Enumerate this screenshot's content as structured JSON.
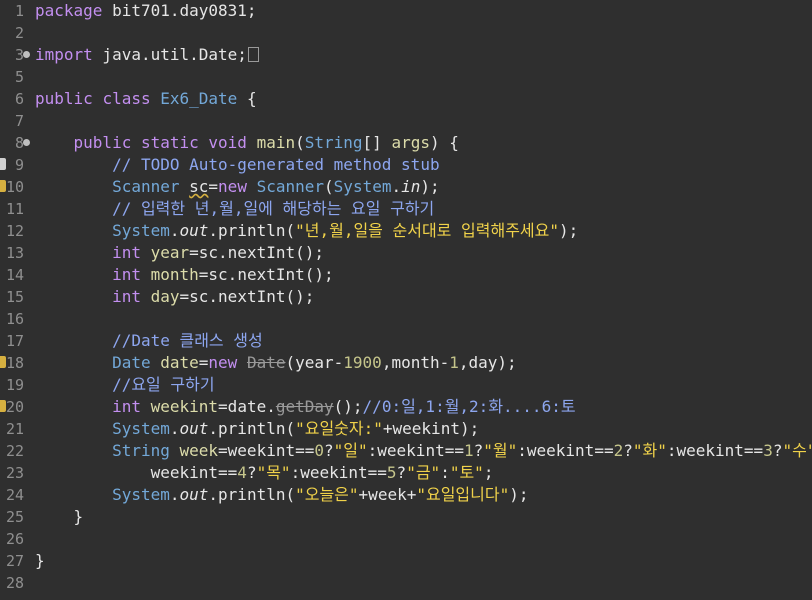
{
  "editor": {
    "lines": [
      {
        "n": "1",
        "t": [
          {
            "c": "kw",
            "v": "package"
          },
          {
            "c": "",
            "v": " bit701.day0831;"
          }
        ]
      },
      {
        "n": "2",
        "t": []
      },
      {
        "n": "3",
        "marker": true,
        "t": [
          {
            "c": "kw",
            "v": "import"
          },
          {
            "c": "",
            "v": " java.util.Date;"
          },
          {
            "c": "box",
            "v": ""
          }
        ]
      },
      {
        "n": "5",
        "t": []
      },
      {
        "n": "6",
        "t": [
          {
            "c": "kw",
            "v": "public"
          },
          {
            "c": "",
            "v": " "
          },
          {
            "c": "kw",
            "v": "class"
          },
          {
            "c": "",
            "v": " "
          },
          {
            "c": "ty",
            "v": "Ex6_Date"
          },
          {
            "c": "",
            "v": " {"
          }
        ]
      },
      {
        "n": "7",
        "t": []
      },
      {
        "n": "8",
        "marker": true,
        "t": [
          {
            "c": "",
            "v": "    "
          },
          {
            "c": "kw",
            "v": "public"
          },
          {
            "c": "",
            "v": " "
          },
          {
            "c": "kw",
            "v": "static"
          },
          {
            "c": "",
            "v": " "
          },
          {
            "c": "kw",
            "v": "void"
          },
          {
            "c": "",
            "v": " "
          },
          {
            "c": "fld",
            "v": "main"
          },
          {
            "c": "",
            "v": "("
          },
          {
            "c": "ty",
            "v": "String"
          },
          {
            "c": "",
            "v": "[] "
          },
          {
            "c": "fld",
            "v": "args"
          },
          {
            "c": "",
            "v": ") {"
          }
        ]
      },
      {
        "n": "9",
        "ann": "note",
        "t": [
          {
            "c": "",
            "v": "        "
          },
          {
            "c": "cm",
            "v": "// TODO Auto-generated method stub"
          }
        ]
      },
      {
        "n": "10",
        "ann": "warn",
        "t": [
          {
            "c": "",
            "v": "        "
          },
          {
            "c": "ty",
            "v": "Scanner"
          },
          {
            "c": "",
            "v": " "
          },
          {
            "c": "warnu",
            "v": "sc"
          },
          {
            "c": "",
            "v": "="
          },
          {
            "c": "kw",
            "v": "new"
          },
          {
            "c": "",
            "v": " "
          },
          {
            "c": "ty",
            "v": "Scanner"
          },
          {
            "c": "",
            "v": "("
          },
          {
            "c": "ty",
            "v": "System"
          },
          {
            "c": "",
            "v": "."
          },
          {
            "c": "ital",
            "v": "in"
          },
          {
            "c": "",
            "v": ");"
          }
        ]
      },
      {
        "n": "11",
        "t": [
          {
            "c": "",
            "v": "        "
          },
          {
            "c": "cm",
            "v": "// 입력한 년,월,일에 해당하는 요일 구하기"
          }
        ]
      },
      {
        "n": "12",
        "t": [
          {
            "c": "",
            "v": "        "
          },
          {
            "c": "ty",
            "v": "System"
          },
          {
            "c": "",
            "v": "."
          },
          {
            "c": "ital",
            "v": "out"
          },
          {
            "c": "",
            "v": ".println("
          },
          {
            "c": "st",
            "v": "\"년,월,일을 순서대로 입력해주세요\""
          },
          {
            "c": "",
            "v": ");"
          }
        ]
      },
      {
        "n": "13",
        "t": [
          {
            "c": "",
            "v": "        "
          },
          {
            "c": "kw",
            "v": "int"
          },
          {
            "c": "",
            "v": " "
          },
          {
            "c": "fld",
            "v": "year"
          },
          {
            "c": "",
            "v": "=sc.nextInt();"
          }
        ]
      },
      {
        "n": "14",
        "t": [
          {
            "c": "",
            "v": "        "
          },
          {
            "c": "kw",
            "v": "int"
          },
          {
            "c": "",
            "v": " "
          },
          {
            "c": "fld",
            "v": "month"
          },
          {
            "c": "",
            "v": "=sc.nextInt();"
          }
        ]
      },
      {
        "n": "15",
        "t": [
          {
            "c": "",
            "v": "        "
          },
          {
            "c": "kw",
            "v": "int"
          },
          {
            "c": "",
            "v": " "
          },
          {
            "c": "fld",
            "v": "day"
          },
          {
            "c": "",
            "v": "=sc.nextInt();"
          }
        ]
      },
      {
        "n": "16",
        "t": []
      },
      {
        "n": "17",
        "t": [
          {
            "c": "",
            "v": "        "
          },
          {
            "c": "cm",
            "v": "//Date 클래스 생성"
          }
        ]
      },
      {
        "n": "18",
        "ann": "warn",
        "t": [
          {
            "c": "",
            "v": "        "
          },
          {
            "c": "ty",
            "v": "Date"
          },
          {
            "c": "",
            "v": " "
          },
          {
            "c": "fld",
            "v": "date"
          },
          {
            "c": "",
            "v": "="
          },
          {
            "c": "kw",
            "v": "new"
          },
          {
            "c": "",
            "v": " "
          },
          {
            "c": "dep",
            "v": "Date"
          },
          {
            "c": "",
            "v": "(year-"
          },
          {
            "c": "num",
            "v": "1900"
          },
          {
            "c": "",
            "v": ",month-"
          },
          {
            "c": "num",
            "v": "1"
          },
          {
            "c": "",
            "v": ",day);"
          }
        ]
      },
      {
        "n": "19",
        "t": [
          {
            "c": "",
            "v": "        "
          },
          {
            "c": "cm",
            "v": "//요일 구하기"
          }
        ]
      },
      {
        "n": "20",
        "ann": "warn",
        "t": [
          {
            "c": "",
            "v": "        "
          },
          {
            "c": "kw",
            "v": "int"
          },
          {
            "c": "",
            "v": " "
          },
          {
            "c": "fld",
            "v": "weekint"
          },
          {
            "c": "",
            "v": "=date."
          },
          {
            "c": "dep",
            "v": "getDay"
          },
          {
            "c": "",
            "v": "();"
          },
          {
            "c": "cm",
            "v": "//0:일,1:월,2:화....6:토"
          }
        ]
      },
      {
        "n": "21",
        "t": [
          {
            "c": "",
            "v": "        "
          },
          {
            "c": "ty",
            "v": "System"
          },
          {
            "c": "",
            "v": "."
          },
          {
            "c": "ital",
            "v": "out"
          },
          {
            "c": "",
            "v": ".println("
          },
          {
            "c": "st",
            "v": "\"요일숫자:\""
          },
          {
            "c": "",
            "v": "+weekint);"
          }
        ]
      },
      {
        "n": "22",
        "t": [
          {
            "c": "",
            "v": "        "
          },
          {
            "c": "ty",
            "v": "String"
          },
          {
            "c": "",
            "v": " "
          },
          {
            "c": "fld",
            "v": "week"
          },
          {
            "c": "",
            "v": "=weekint=="
          },
          {
            "c": "num",
            "v": "0"
          },
          {
            "c": "",
            "v": "?"
          },
          {
            "c": "st",
            "v": "\"일\""
          },
          {
            "c": "",
            "v": ":weekint=="
          },
          {
            "c": "num",
            "v": "1"
          },
          {
            "c": "",
            "v": "?"
          },
          {
            "c": "st",
            "v": "\"월\""
          },
          {
            "c": "",
            "v": ":weekint=="
          },
          {
            "c": "num",
            "v": "2"
          },
          {
            "c": "",
            "v": "?"
          },
          {
            "c": "st",
            "v": "\"화\""
          },
          {
            "c": "",
            "v": ":weekint=="
          },
          {
            "c": "num",
            "v": "3"
          },
          {
            "c": "",
            "v": "?"
          },
          {
            "c": "st",
            "v": "\"수\""
          },
          {
            "c": "",
            "v": ":"
          }
        ]
      },
      {
        "n": "23",
        "t": [
          {
            "c": "",
            "v": "            weekint=="
          },
          {
            "c": "num",
            "v": "4"
          },
          {
            "c": "",
            "v": "?"
          },
          {
            "c": "st",
            "v": "\"목\""
          },
          {
            "c": "",
            "v": ":weekint=="
          },
          {
            "c": "num",
            "v": "5"
          },
          {
            "c": "",
            "v": "?"
          },
          {
            "c": "st",
            "v": "\"금\""
          },
          {
            "c": "",
            "v": ":"
          },
          {
            "c": "st",
            "v": "\"토\""
          },
          {
            "c": "",
            "v": ";"
          }
        ]
      },
      {
        "n": "24",
        "t": [
          {
            "c": "",
            "v": "        "
          },
          {
            "c": "ty",
            "v": "System"
          },
          {
            "c": "",
            "v": "."
          },
          {
            "c": "ital",
            "v": "out"
          },
          {
            "c": "",
            "v": ".println("
          },
          {
            "c": "st",
            "v": "\"오늘은\""
          },
          {
            "c": "",
            "v": "+week+"
          },
          {
            "c": "st",
            "v": "\"요일입니다\""
          },
          {
            "c": "",
            "v": ");"
          }
        ]
      },
      {
        "n": "25",
        "t": [
          {
            "c": "",
            "v": "    }"
          }
        ]
      },
      {
        "n": "26",
        "t": []
      },
      {
        "n": "27",
        "t": [
          {
            "c": "",
            "v": "}"
          }
        ]
      },
      {
        "n": "28",
        "t": []
      }
    ]
  },
  "colors": {
    "background": "#2f2f2f",
    "keyword": "#c38ff0",
    "comment": "#8da6ef",
    "type": "#73a8d8",
    "string": "#f0d24a",
    "line_number": "#8f8f8f"
  }
}
